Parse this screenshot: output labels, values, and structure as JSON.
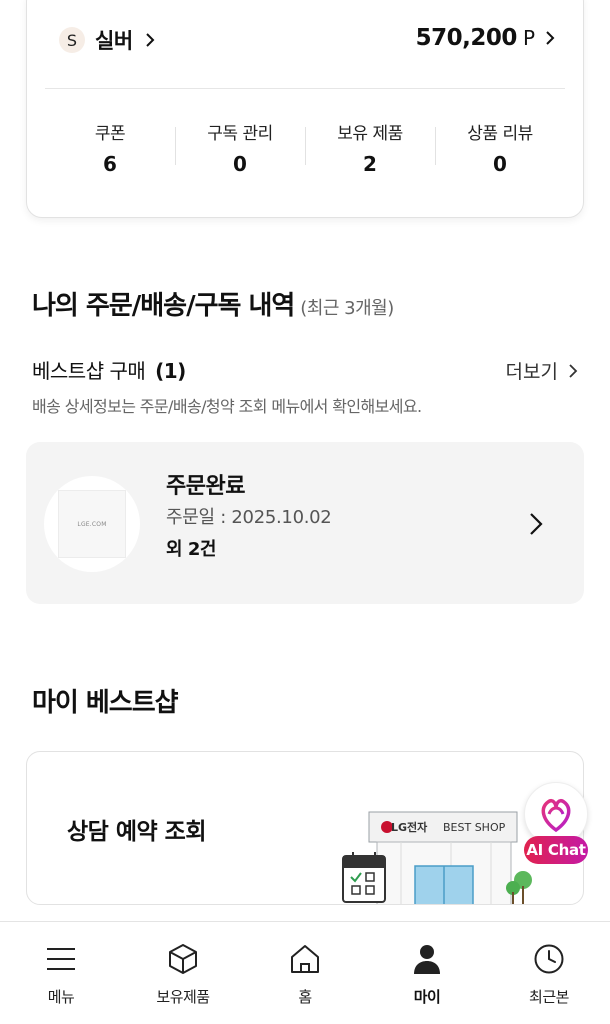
{
  "membership": {
    "grade_initial": "S",
    "grade_name": "실버",
    "points_value": "570,200",
    "points_unit": "P",
    "stats": [
      {
        "label": "쿠폰",
        "value": "6"
      },
      {
        "label": "구독 관리",
        "value": "0"
      },
      {
        "label": "보유 제품",
        "value": "2"
      },
      {
        "label": "상품 리뷰",
        "value": "0"
      }
    ]
  },
  "orders": {
    "title": "나의 주문/배송/구독 내역",
    "subtitle": "(최근 3개월)",
    "shop_purchase_label": "베스트샵 구매",
    "shop_purchase_count": "(1)",
    "more_label": "더보기",
    "note": "배송 상세정보는 주문/배송/청약 조회 메뉴에서 확인해보세요.",
    "card": {
      "status": "주문완료",
      "date": "주문일 : 2025.10.02",
      "extra": "외 2건",
      "thumb_text": "LGE.COM"
    }
  },
  "my_best_shop": {
    "title": "마이 베스트샵",
    "consult_label": "상담 예약 조회",
    "store_brand": "LG전자",
    "store_name": "BEST SHOP"
  },
  "ai_chat": {
    "label": "AI Chat"
  },
  "bottom_nav": {
    "items": [
      {
        "label": "메뉴",
        "icon": "menu-icon"
      },
      {
        "label": "보유제품",
        "icon": "box-icon"
      },
      {
        "label": "홈",
        "icon": "home-icon"
      },
      {
        "label": "마이",
        "icon": "person-icon",
        "active": true
      },
      {
        "label": "최근본",
        "icon": "clock-icon"
      }
    ]
  },
  "colors": {
    "accent": "#d6003a",
    "card_bg": "#f4f4f4",
    "ai_gradient_start": "#e0224e",
    "ai_gradient_end": "#c41aa6"
  }
}
